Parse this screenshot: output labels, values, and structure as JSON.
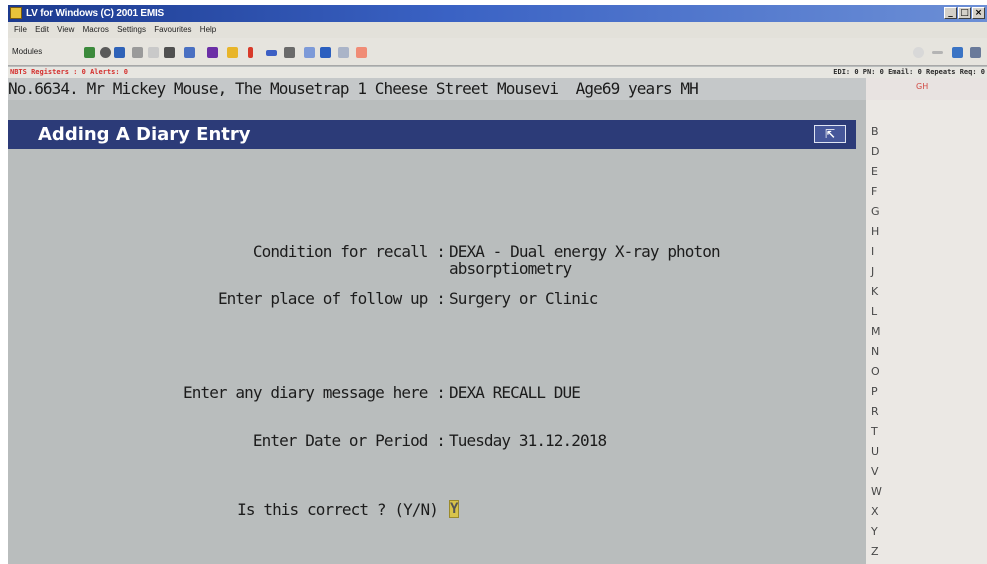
{
  "window": {
    "title": "LV for Windows (C) 2001 EMIS",
    "menu": [
      "File",
      "Edit",
      "View",
      "Macros",
      "Settings",
      "Favourites",
      "Help"
    ],
    "toolbar_modules_label": "Modules"
  },
  "status": {
    "left": "NBTS Registers : 0  Alerts: 0",
    "right": "EDI: 0  PN: 0  Email: 0  Repeats Req: 0"
  },
  "patient": {
    "line": "No.6634. Mr Mickey Mouse, The Mousetrap 1 Cheese Street Mousevi  Age69 years MH"
  },
  "alpha_panel": {
    "header": "GH",
    "letters": [
      "B",
      "D",
      "E",
      "F",
      "G",
      "H",
      "I",
      "J",
      "K",
      "L",
      "M",
      "N",
      "O",
      "P",
      "R",
      "T",
      "U",
      "V",
      "W",
      "X",
      "Y",
      "Z"
    ]
  },
  "screen": {
    "title": "Adding A Diary Entry",
    "icon": "exit-icon"
  },
  "form": {
    "condition_label": "Condition for recall :",
    "condition_value_1": "DEXA - Dual energy X-ray photon",
    "condition_value_2": "absorptiometry",
    "place_label": "Enter place of follow up :",
    "place_value": "Surgery or Clinic",
    "message_label": "Enter any diary message here :",
    "message_value": "DEXA RECALL DUE",
    "date_label": "Enter Date or Period :",
    "date_value": "Tuesday 31.12.2018",
    "confirm_label": "Is this correct ? (Y/N)",
    "confirm_value": "Y"
  },
  "colors": {
    "screen_background": "#b9bdbd",
    "header_background": "#2c3b78",
    "status_alert": "#d4302e",
    "cursor": "#d8c34a"
  }
}
